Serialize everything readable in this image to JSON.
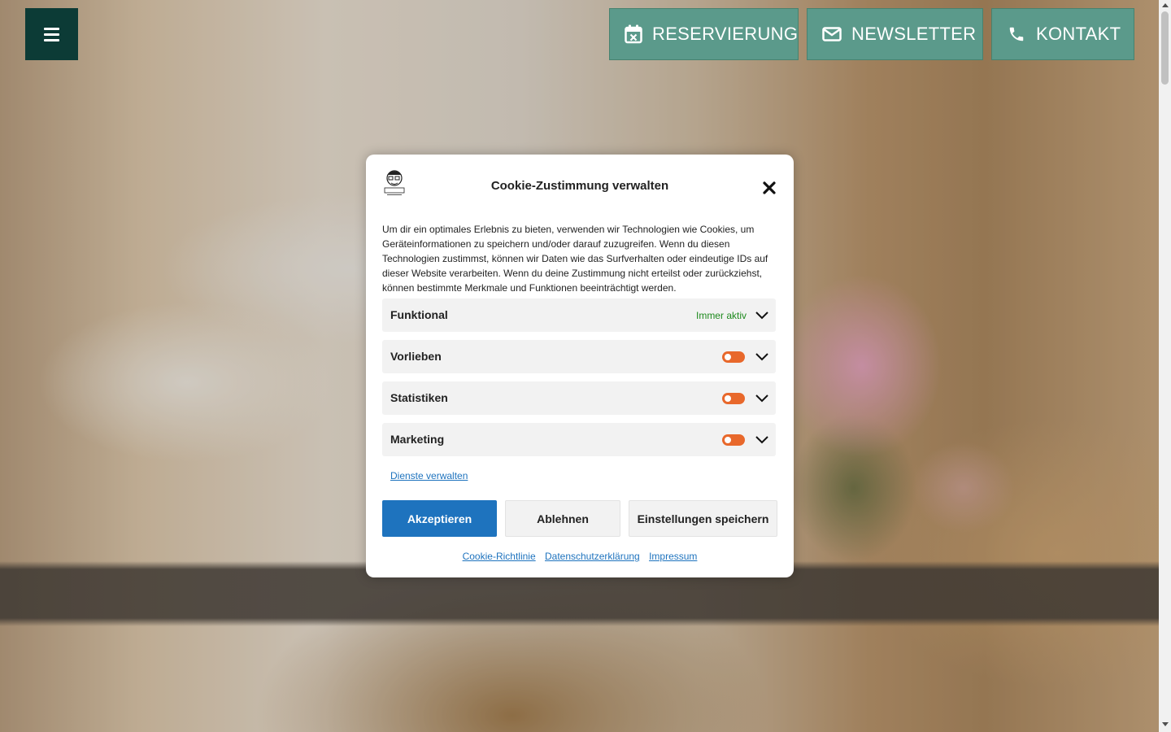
{
  "header": {
    "menu_icon": "hamburger-icon",
    "buttons": [
      {
        "label": "RESERVIERUNG",
        "icon": "calendar-x-icon"
      },
      {
        "label": "NEWSLETTER",
        "icon": "envelope-icon"
      },
      {
        "label": "KONTAKT",
        "icon": "phone-icon"
      }
    ],
    "button_color": "#5b9a8b",
    "menu_color": "#0c3b36"
  },
  "cookie_modal": {
    "title": "Cookie-Zustimmung verwalten",
    "close_icon": "close-icon",
    "text": "Um dir ein optimales Erlebnis zu bieten, verwenden wir Technologien wie Cookies, um Geräteinformationen zu speichern und/oder darauf zuzugreifen. Wenn du diesen Technologien zustimmst, können wir Daten wie das Surfverhalten oder eindeutige IDs auf dieser Website verarbeiten. Wenn du deine Zustimmung nicht erteilst oder zurückziehst, können bestimmte Merkmale und Funktionen beeinträchtigt werden.",
    "categories": [
      {
        "label": "Funktional",
        "status": "Immer aktiv"
      },
      {
        "label": "Vorlieben",
        "toggle": "off"
      },
      {
        "label": "Statistiken",
        "toggle": "off"
      },
      {
        "label": "Marketing",
        "toggle": "off"
      }
    ],
    "manage_link": "Dienste verwalten",
    "buttons": {
      "accept": "Akzeptieren",
      "deny": "Ablehnen",
      "save": "Einstellungen speichern"
    },
    "footer_links": [
      "Cookie-Richtlinie",
      "Datenschutzerklärung",
      "Impressum"
    ],
    "accent_color": "#1e73be",
    "toggle_color": "#e8682b",
    "active_color": "#1e8a1e"
  }
}
